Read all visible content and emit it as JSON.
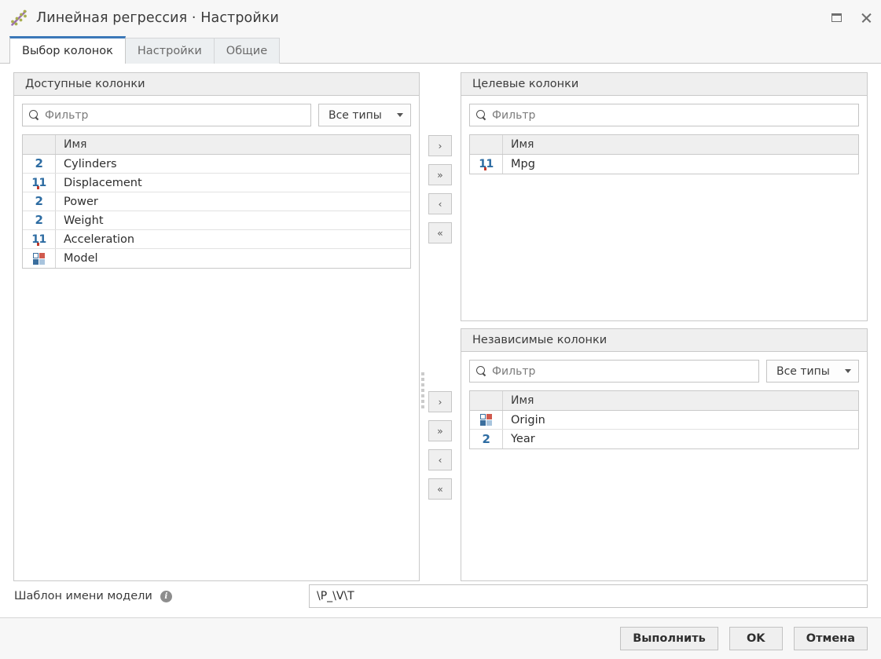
{
  "window": {
    "title": "Линейная регрессия · Настройки",
    "icon": "linear-regression-icon",
    "controls": {
      "maximize": "maximize-icon",
      "close": "close-icon"
    }
  },
  "tabs": [
    {
      "label": "Выбор колонок",
      "active": true
    },
    {
      "label": "Настройки",
      "active": false
    },
    {
      "label": "Общие",
      "active": false
    }
  ],
  "panels": {
    "available": {
      "title": "Доступные колонки",
      "filter_placeholder": "Фильтр",
      "filter_value": "",
      "type_filter": "Все типы",
      "column_header": "Имя",
      "rows": [
        {
          "type": "integer",
          "glyph": "2",
          "name": "Cylinders"
        },
        {
          "type": "double",
          "glyph": "1.1",
          "name": "Displacement"
        },
        {
          "type": "integer",
          "glyph": "2",
          "name": "Power"
        },
        {
          "type": "integer",
          "glyph": "2",
          "name": "Weight"
        },
        {
          "type": "double",
          "glyph": "1.1",
          "name": "Acceleration"
        },
        {
          "type": "string",
          "glyph": "squares",
          "name": "Model"
        }
      ]
    },
    "target": {
      "title": "Целевые колонки",
      "filter_placeholder": "Фильтр",
      "filter_value": "",
      "column_header": "Имя",
      "rows": [
        {
          "type": "double",
          "glyph": "1.1",
          "name": "Mpg"
        }
      ]
    },
    "independent": {
      "title": "Независимые колонки",
      "filter_placeholder": "Фильтр",
      "filter_value": "",
      "type_filter": "Все типы",
      "column_header": "Имя",
      "rows": [
        {
          "type": "string",
          "glyph": "squares",
          "name": "Origin"
        },
        {
          "type": "integer",
          "glyph": "2",
          "name": "Year"
        }
      ]
    }
  },
  "transfer_top": [
    {
      "name": "add-one-button",
      "glyph": "›"
    },
    {
      "name": "add-all-button",
      "glyph": "»"
    },
    {
      "name": "remove-one-button",
      "glyph": "‹"
    },
    {
      "name": "remove-all-button",
      "glyph": "«"
    }
  ],
  "transfer_bottom": [
    {
      "name": "add-one-button",
      "glyph": "›"
    },
    {
      "name": "add-all-button",
      "glyph": "»"
    },
    {
      "name": "remove-one-button",
      "glyph": "‹"
    },
    {
      "name": "remove-all-button",
      "glyph": "«"
    }
  ],
  "model_name": {
    "label": "Шаблон имени модели",
    "info_glyph": "i",
    "value": "\\P_\\V\\T"
  },
  "footer": {
    "execute": "Выполнить",
    "ok": "OK",
    "cancel": "Отмена"
  },
  "colors": {
    "accent": "#3b78b8",
    "panel_header": "#efefef",
    "type_blue": "#2d6ca2",
    "type_red": "#c0392b",
    "window_bg": "#f7f7f7"
  }
}
